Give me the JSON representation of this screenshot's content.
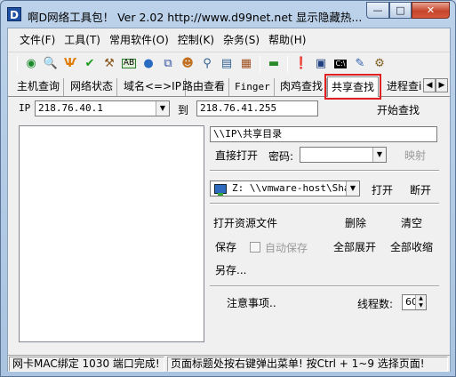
{
  "window": {
    "title": "啊D网络工具包！ Ver 2.02   http://www.d99net.net  显示隐藏热...",
    "app_icon_letter": "D",
    "minimize": "—",
    "maximize": "□",
    "close": "✕"
  },
  "menu": [
    "文件(F)",
    "工具(T)",
    "常用软件(O)",
    "控制(K)",
    "杂务(S)",
    "帮助(H)"
  ],
  "toolbar": {
    "icons": [
      "refresh-icon",
      "search-icon",
      "scan-icon",
      "check-icon",
      "tools-icon",
      "ab-icon",
      "globe-icon",
      "network-icon",
      "user-icon",
      "users-search-icon",
      "computers-icon",
      "server-icon",
      "ethernet-icon",
      "info-icon",
      "monitor-icon",
      "cmd-icon",
      "pen-icon",
      "user-settings-icon"
    ]
  },
  "tabs": {
    "items": [
      "主机查询",
      "网络状态",
      "域名<=>IP",
      "路由查看",
      "Finger",
      "肉鸡查找",
      "共享查找",
      "进程查i"
    ],
    "active": "共享查找",
    "scroll_left": "◀",
    "scroll_right": "▶"
  },
  "search": {
    "ip_label": "IP",
    "ip_from": "218.76.40.1",
    "to_label": "到",
    "ip_to": "218.76.41.255",
    "start_button": "开始查找"
  },
  "share": {
    "path_value": "\\\\IP\\共享目录",
    "direct_open": "直接打开",
    "password_label": "密码:",
    "password_value": "",
    "map_button": "映射",
    "drive_value": "Z:  \\\\vmware-host\\Shar",
    "open_button": "打开",
    "disconnect_button": "断开",
    "open_resource_file": "打开资源文件",
    "delete_button": "删除",
    "clear_button": "清空",
    "save_button": "保存",
    "autosave_label": "自动保存",
    "expand_all": "全部展开",
    "collapse_all": "全部收缩",
    "save_as": "另存...",
    "notes_button": "注意事项..",
    "threads_label": "线程数:",
    "threads_value": "60"
  },
  "status": {
    "left": "网卡MAC绑定 1030 端口完成!",
    "right": "页面标题处按右键弹出菜单! 按Ctrl + 1~9 选择页面!"
  }
}
